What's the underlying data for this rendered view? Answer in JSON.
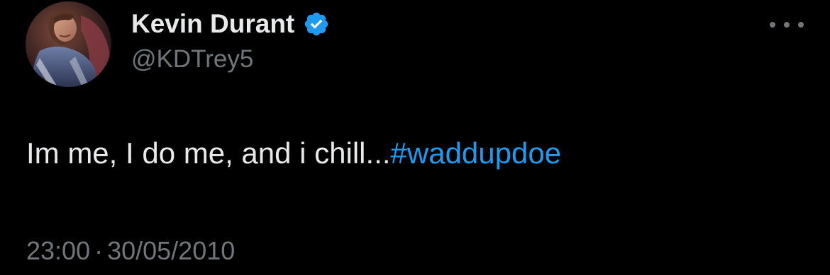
{
  "colors": {
    "background": "#000000",
    "text_primary": "#e7e9ea",
    "text_secondary": "#71767b",
    "accent": "#1d9bf0"
  },
  "author": {
    "display_name": "Kevin Durant",
    "handle": "@KDTrey5",
    "verified_icon": "verified-badge-icon",
    "avatar": "avatar"
  },
  "more_icon": "more-options-icon",
  "tweet": {
    "text": "Im me, I do me, and i chill...",
    "hashtag": "#waddupdoe"
  },
  "meta": {
    "time": "23:00",
    "separator": "·",
    "date": "30/05/2010"
  }
}
